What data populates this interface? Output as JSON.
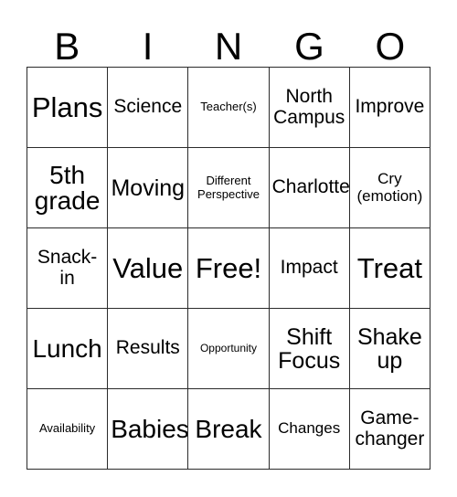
{
  "card": {
    "title": "BINGO",
    "header_letters": [
      "B",
      "I",
      "N",
      "G",
      "O"
    ],
    "grid_size": "5x5",
    "free_space_label": "Free!",
    "colors": {
      "background": "#ffffff",
      "border": "#2b2b2b",
      "text": "#000000"
    },
    "rows": [
      [
        {
          "label": "Plans",
          "size": "xxl"
        },
        {
          "label": "Science",
          "size": "md"
        },
        {
          "label": "Teacher(s)",
          "size": "xs"
        },
        {
          "label": "North\nCampus",
          "size": "md"
        },
        {
          "label": "Improve",
          "size": "md"
        }
      ],
      [
        {
          "label": "5th\ngrade",
          "size": "xl"
        },
        {
          "label": "Moving",
          "size": "lg"
        },
        {
          "label": "Different\nPerspective",
          "size": "xs"
        },
        {
          "label": "Charlotte",
          "size": "md"
        },
        {
          "label": "Cry\n(emotion)",
          "size": "sm"
        }
      ],
      [
        {
          "label": "Snack-\nin",
          "size": "md"
        },
        {
          "label": "Value",
          "size": "xxl"
        },
        {
          "label": "Free!",
          "size": "xxl"
        },
        {
          "label": "Impact",
          "size": "md"
        },
        {
          "label": "Treat",
          "size": "xxl"
        }
      ],
      [
        {
          "label": "Lunch",
          "size": "xl"
        },
        {
          "label": "Results",
          "size": "md"
        },
        {
          "label": "Opportunity",
          "size": "xxs"
        },
        {
          "label": "Shift\nFocus",
          "size": "lg"
        },
        {
          "label": "Shake\nup",
          "size": "lg"
        }
      ],
      [
        {
          "label": "Availability",
          "size": "xs"
        },
        {
          "label": "Babies",
          "size": "xl"
        },
        {
          "label": "Break",
          "size": "xl"
        },
        {
          "label": "Changes",
          "size": "sm"
        },
        {
          "label": "Game-\nchanger",
          "size": "md"
        }
      ]
    ]
  }
}
